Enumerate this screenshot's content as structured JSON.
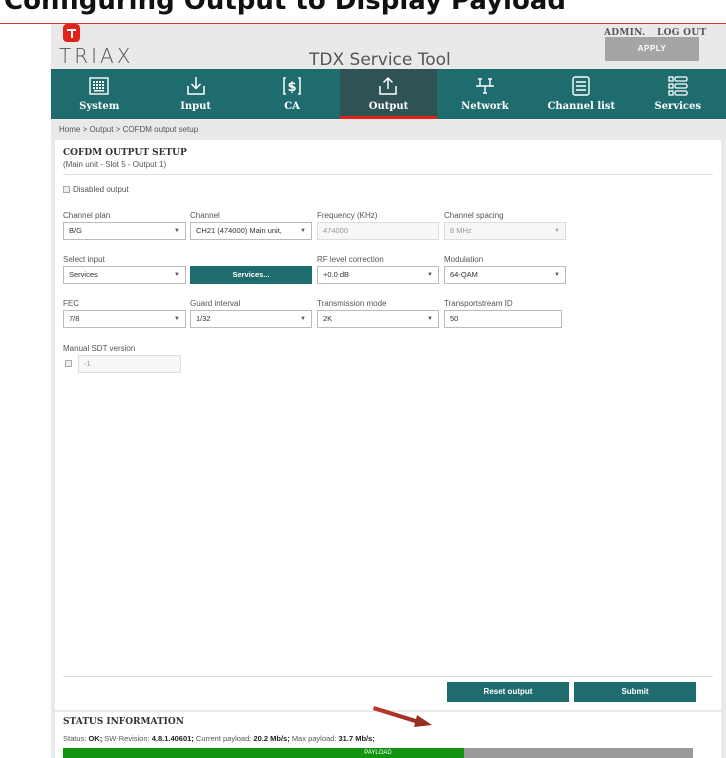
{
  "page_heading": "Configuring Output to Display Payload",
  "app": {
    "logo_text": "TRIAX",
    "title": "TDX Service Tool",
    "admin_link": "ADMIN.",
    "logout_link": "LOG OUT",
    "apply_label": "APPLY"
  },
  "nav": {
    "items": [
      {
        "label": "System",
        "icon": "keyboard-icon"
      },
      {
        "label": "Input",
        "icon": "download-icon"
      },
      {
        "label": "CA",
        "icon": "dollar-icon"
      },
      {
        "label": "Output",
        "icon": "upload-icon",
        "active": true
      },
      {
        "label": "Network",
        "icon": "network-icon"
      },
      {
        "label": "Channel list",
        "icon": "list-icon"
      },
      {
        "label": "Services",
        "icon": "services-icon"
      }
    ]
  },
  "breadcrumb": "Home  >  Output  >  COFDM output setup",
  "panel": {
    "title": "COFDM OUTPUT SETUP",
    "subtitle": "(Main unit - Slot 5 - Output 1)",
    "disabled_output_label": "Disabled output",
    "channel_plan": {
      "label": "Channel plan",
      "value": "B/G"
    },
    "channel": {
      "label": "Channel",
      "value": "CH21 (474000) Main unit,"
    },
    "frequency": {
      "label": "Frequency (KHz)",
      "value": "474000"
    },
    "channel_spacing": {
      "label": "Channel spacing",
      "value": "8 MHz"
    },
    "select_input": {
      "label": "Select input",
      "value": "Services"
    },
    "services_button": "Services...",
    "rf_level": {
      "label": "RF level correction",
      "value": "+0.0 dB"
    },
    "modulation": {
      "label": "Modulation",
      "value": "64-QAM"
    },
    "fec": {
      "label": "FEC",
      "value": "7/8"
    },
    "guard_interval": {
      "label": "Guard interval",
      "value": "1/32"
    },
    "transmission_mode": {
      "label": "Transmission mode",
      "value": "2K"
    },
    "transportstream_id": {
      "label": "Transportstream ID",
      "value": "50"
    },
    "manual_sdt": {
      "label": "Manual SDT version",
      "value": "-1"
    },
    "reset_button": "Reset output",
    "submit_button": "Submit"
  },
  "status": {
    "title": "STATUS INFORMATION",
    "status_label": "Status:",
    "status_value": "OK;",
    "sw_label": "SW-Revision:",
    "sw_value": "4.8.1.40601;",
    "current_label": "Current payload:",
    "current_value": "20.2 Mb/s;",
    "max_label": "Max payload:",
    "max_value": "31.7 Mb/s;",
    "payload_label": "PAYLOAD",
    "payload_fraction": 0.6372
  },
  "colors": {
    "teal": "#1e6c6e",
    "teal_active": "#2f5255",
    "brand_red": "#e2231a",
    "payload_green": "#129312",
    "annotation_arrow": "#b2322a"
  }
}
